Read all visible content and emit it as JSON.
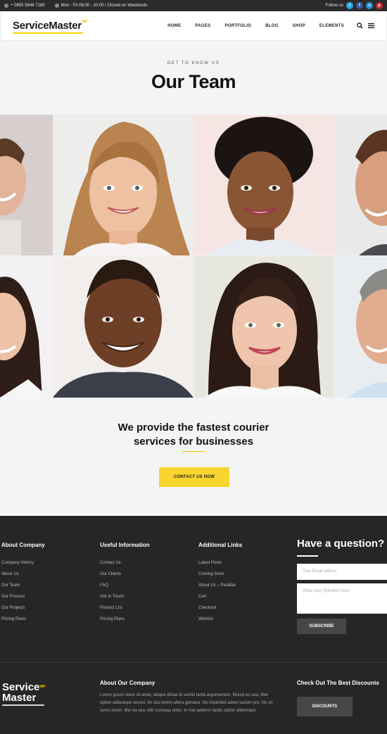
{
  "topbar": {
    "phone": "+ 0855 5646 7189",
    "hours": "Mon - Fri 08:00 - 20:00 / Closed on Weekends",
    "follow": "Follow us",
    "socials": [
      {
        "name": "twitter",
        "glyph": "t",
        "color": "#29a9e1"
      },
      {
        "name": "facebook",
        "glyph": "f",
        "color": "#3b5998"
      },
      {
        "name": "skype",
        "glyph": "s",
        "color": "#2c8fd8"
      },
      {
        "name": "pinterest",
        "glyph": "p",
        "color": "#cb2027"
      }
    ]
  },
  "header": {
    "logo": "ServiceMaster",
    "logo_badge": "WP",
    "nav": [
      "HOME",
      "PAGES",
      "PORTFOLIO",
      "BLOG",
      "SHOP",
      "ELEMENTS"
    ]
  },
  "intro": {
    "eyebrow": "GET TO KNOW US",
    "title": "Our Team"
  },
  "cta": {
    "line1": "We provide the fastest courier",
    "line2": "services for businesses",
    "button": "CONTACT US NOW"
  },
  "footer": {
    "columns": [
      {
        "title": "About Company",
        "items": [
          "Company History",
          "About Us",
          "Our Team",
          "Our Process",
          "Our Projects",
          "Pricing Plans"
        ]
      },
      {
        "title": "Useful Information",
        "items": [
          "Contact Us",
          "Our Clients",
          "FAQ",
          "Get In Touch",
          "Product List",
          "Pricing Plans"
        ]
      },
      {
        "title": "Additional Links",
        "items": [
          "Latest Posts",
          "Coming Soon",
          "About Us – Parallax",
          "Cart",
          "Checkout",
          "Wishlist"
        ]
      }
    ],
    "question": {
      "title": "Have a question?",
      "email_placeholder": "Your Email adress",
      "question_placeholder": "Write your Question here",
      "button": "SUBSCRIBE"
    },
    "logo_line1": "Service",
    "logo_line2": "Master",
    "logo_badge": "WP",
    "about_title": "About Our Company",
    "about_text": "Lorem ipsum dolor sit amet, ubique dictas in semel tanta argumentum. Mundi eu sea, liber option alidenique sercivi. An duo lorem altera gloriatur. No imperdiet adver sarium pro. No sit sumo lorem. Mei ea eius elitr consequ untur. In mel aeterno facilis option alidenique.",
    "discounts_title": "Check Out The Best Discounts",
    "discounts_button": "DISCOUNTS"
  },
  "colors": {
    "accent": "#f7d52e",
    "footer_bg": "#262626",
    "page_bg": "#f3f4f5"
  }
}
